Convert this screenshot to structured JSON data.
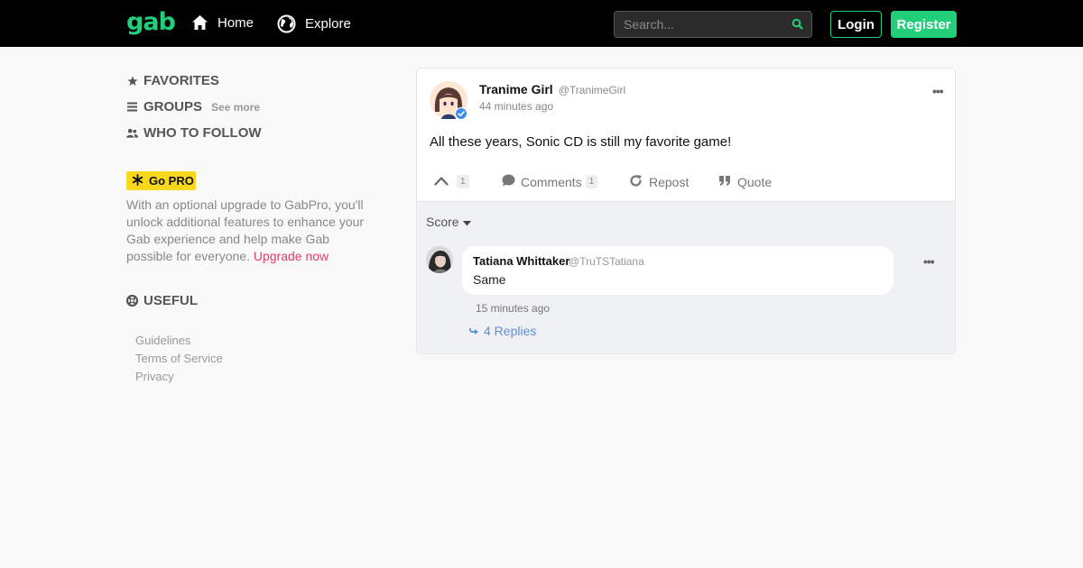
{
  "brand": {
    "logo": "gab",
    "accent_color": "#21cf7a"
  },
  "header": {
    "nav": [
      {
        "label": "Home",
        "icon": "home-icon"
      },
      {
        "label": "Explore",
        "icon": "globe-icon"
      }
    ],
    "search": {
      "placeholder": "Search...",
      "value": ""
    },
    "login_label": "Login",
    "register_label": "Register"
  },
  "sidebar": {
    "favorites": "FAVORITES",
    "groups": "GROUPS",
    "see_more": "See more",
    "who_to_follow": "WHO TO FOLLOW",
    "gopro_label": "Go PRO",
    "pro_text": "With an optional upgrade to GabPro, you'll unlock additional features to enhance your Gab experience and help make Gab possible for everyone.",
    "upgrade_link": "Upgrade now",
    "useful": "USEFUL",
    "links": [
      "Guidelines",
      "Terms of Service",
      "Privacy"
    ]
  },
  "post": {
    "author_name": "Tranime Girl",
    "author_handle": "@TranimeGirl",
    "time": "44 minutes ago",
    "text": "All these years, Sonic CD is still my favorite game!",
    "likes_count": "1",
    "comments_label": "Comments",
    "comments_count": "1",
    "repost_label": "Repost",
    "quote_label": "Quote",
    "verified": true
  },
  "comments": {
    "sort_label": "Score",
    "items": [
      {
        "author_name": "Tatiana Whittaker",
        "author_handle": "@TruTSTatiana",
        "text": "Same",
        "time": "15 minutes ago",
        "replies_label": "4 Replies"
      }
    ]
  }
}
